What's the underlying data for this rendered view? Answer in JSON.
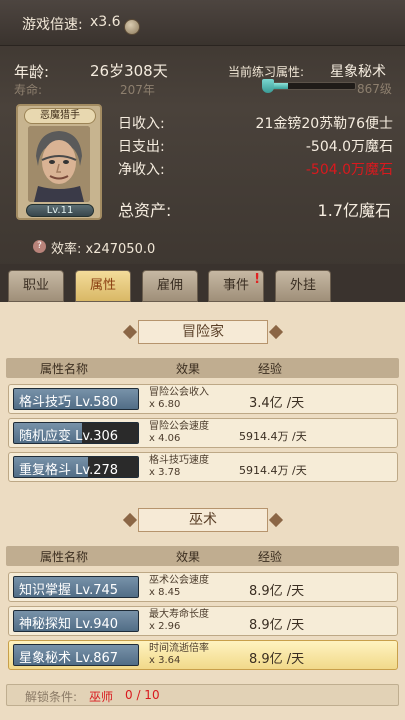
{
  "speed": {
    "label": "游戏倍速:",
    "value": "x3.6"
  },
  "age": {
    "label": "年龄:",
    "value": "26岁308天",
    "life_label": "寿命:",
    "life_value": "207年"
  },
  "practice": {
    "label": "当前练习属性:",
    "value": "星象秘术",
    "progress_fraction": 0.2,
    "level": "867级"
  },
  "portrait": {
    "title": "恶魔猎手",
    "level": "Lv.11"
  },
  "income": {
    "daily_in_label": "日收入:",
    "daily_in": "21金镑20苏勒76便士",
    "daily_out_label": "日支出:",
    "daily_out": "-504.0万魔石",
    "net_label": "净收入:",
    "net": "-504.0万魔石"
  },
  "assets": {
    "label": "总资产:",
    "value": "1.7亿魔石"
  },
  "efficiency": {
    "label": "效率:",
    "value": "x247050.0"
  },
  "tabs": [
    {
      "label": "职业",
      "active": false
    },
    {
      "label": "属性",
      "active": true
    },
    {
      "label": "雇佣",
      "active": false
    },
    {
      "label": "事件",
      "active": false,
      "badge": "!"
    },
    {
      "label": "外挂",
      "active": false
    }
  ],
  "section1": {
    "title": "冒险家",
    "headers": {
      "name": "属性名称",
      "effect": "效果",
      "exp": "经验"
    },
    "rows": [
      {
        "name": "格斗技巧",
        "level": "Lv.580",
        "effect1": "冒险公会收入",
        "effect2": "x 6.80",
        "exp": "3.4亿 /天"
      },
      {
        "name": "随机应变",
        "level": "Lv.306",
        "effect1": "冒险公会速度",
        "effect2": "x 4.06",
        "exp": "5914.4万 /天"
      },
      {
        "name": "重复格斗",
        "level": "Lv.278",
        "effect1": "格斗技巧速度",
        "effect2": "x 3.78",
        "exp": "5914.4万 /天"
      }
    ]
  },
  "section2": {
    "title": "巫术",
    "headers": {
      "name": "属性名称",
      "effect": "效果",
      "exp": "经验"
    },
    "rows": [
      {
        "name": "知识掌握",
        "level": "Lv.745",
        "effect1": "巫术公会速度",
        "effect2": "x 8.45",
        "exp": "8.9亿 /天"
      },
      {
        "name": "神秘探知",
        "level": "Lv.940",
        "effect1": "最大寿命长度",
        "effect2": "x 2.96",
        "exp": "8.9亿 /天"
      },
      {
        "name": "星象秘术",
        "level": "Lv.867",
        "effect1": "时间流逝倍率",
        "effect2": "x 3.64",
        "exp": "8.9亿 /天"
      }
    ]
  },
  "unlock": {
    "label": "解锁条件:",
    "role": "巫师",
    "count": "0 / 10"
  },
  "colors": {
    "negative": "#d9191e",
    "active_tab": "#d9b866",
    "skill_bar": "#4f6b85"
  }
}
